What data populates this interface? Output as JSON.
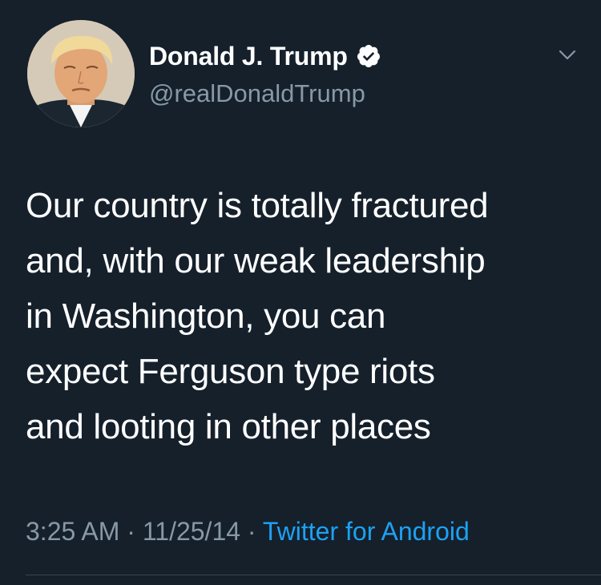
{
  "author": {
    "display_name": "Donald J. Trump",
    "handle": "@realDonaldTrump",
    "verified": true
  },
  "tweet": {
    "text": "Our country is totally fractured\nand, with our weak leadership\nin Washington, you can\nexpect Ferguson type riots\nand looting in other places",
    "time": "3:25 AM",
    "separator": " · ",
    "date": "11/25/14",
    "source": "Twitter for Android"
  },
  "icons": {
    "verified": "verified-badge-icon",
    "menu": "chevron-down-icon"
  },
  "colors": {
    "background": "#15202b",
    "primary_text": "#ffffff",
    "secondary_text": "#8899a6",
    "link": "#1da1f2",
    "divider": "#38444d"
  }
}
